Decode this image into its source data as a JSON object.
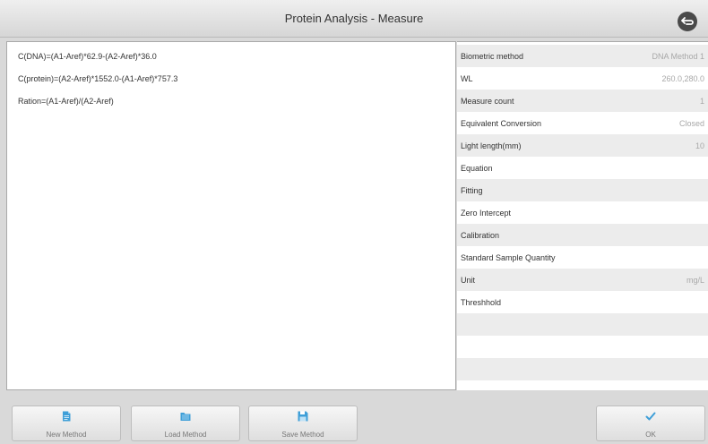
{
  "window": {
    "title": "Protein Analysis - Measure"
  },
  "equations": [
    "C(DNA)=(A1-Aref)*62.9-(A2-Aref)*36.0",
    "C(protein)=(A2-Aref)*1552.0-(A1-Aref)*757.3",
    "Ration=(A1-Aref)/(A2-Aref)"
  ],
  "params": [
    {
      "label": "Biometric method",
      "value": "DNA Method 1"
    },
    {
      "label": "WL",
      "value": "260.0,280.0"
    },
    {
      "label": "Measure count",
      "value": "1"
    },
    {
      "label": "Equivalent Conversion",
      "value": "Closed"
    },
    {
      "label": "Light length(mm)",
      "value": "10"
    },
    {
      "label": "Equation",
      "value": ""
    },
    {
      "label": "Fitting",
      "value": ""
    },
    {
      "label": "Zero Intercept",
      "value": ""
    },
    {
      "label": "Calibration",
      "value": ""
    },
    {
      "label": "Standard Sample Quantity",
      "value": ""
    },
    {
      "label": "Unit",
      "value": "mg/L"
    },
    {
      "label": "Threshhold",
      "value": ""
    }
  ],
  "toolbar": {
    "new_method": "New Method",
    "load_method": "Load Method",
    "save_method": "Save Method",
    "ok": "OK"
  },
  "icons": {
    "back": "back-arrow-icon",
    "new": "document-icon",
    "load": "folder-open-icon",
    "save": "save-icon",
    "ok": "checkmark-icon"
  },
  "colors": {
    "icon_blue": "#3f9fd8",
    "row_alt": "#ececec",
    "value_gray": "#a8a8a8"
  }
}
